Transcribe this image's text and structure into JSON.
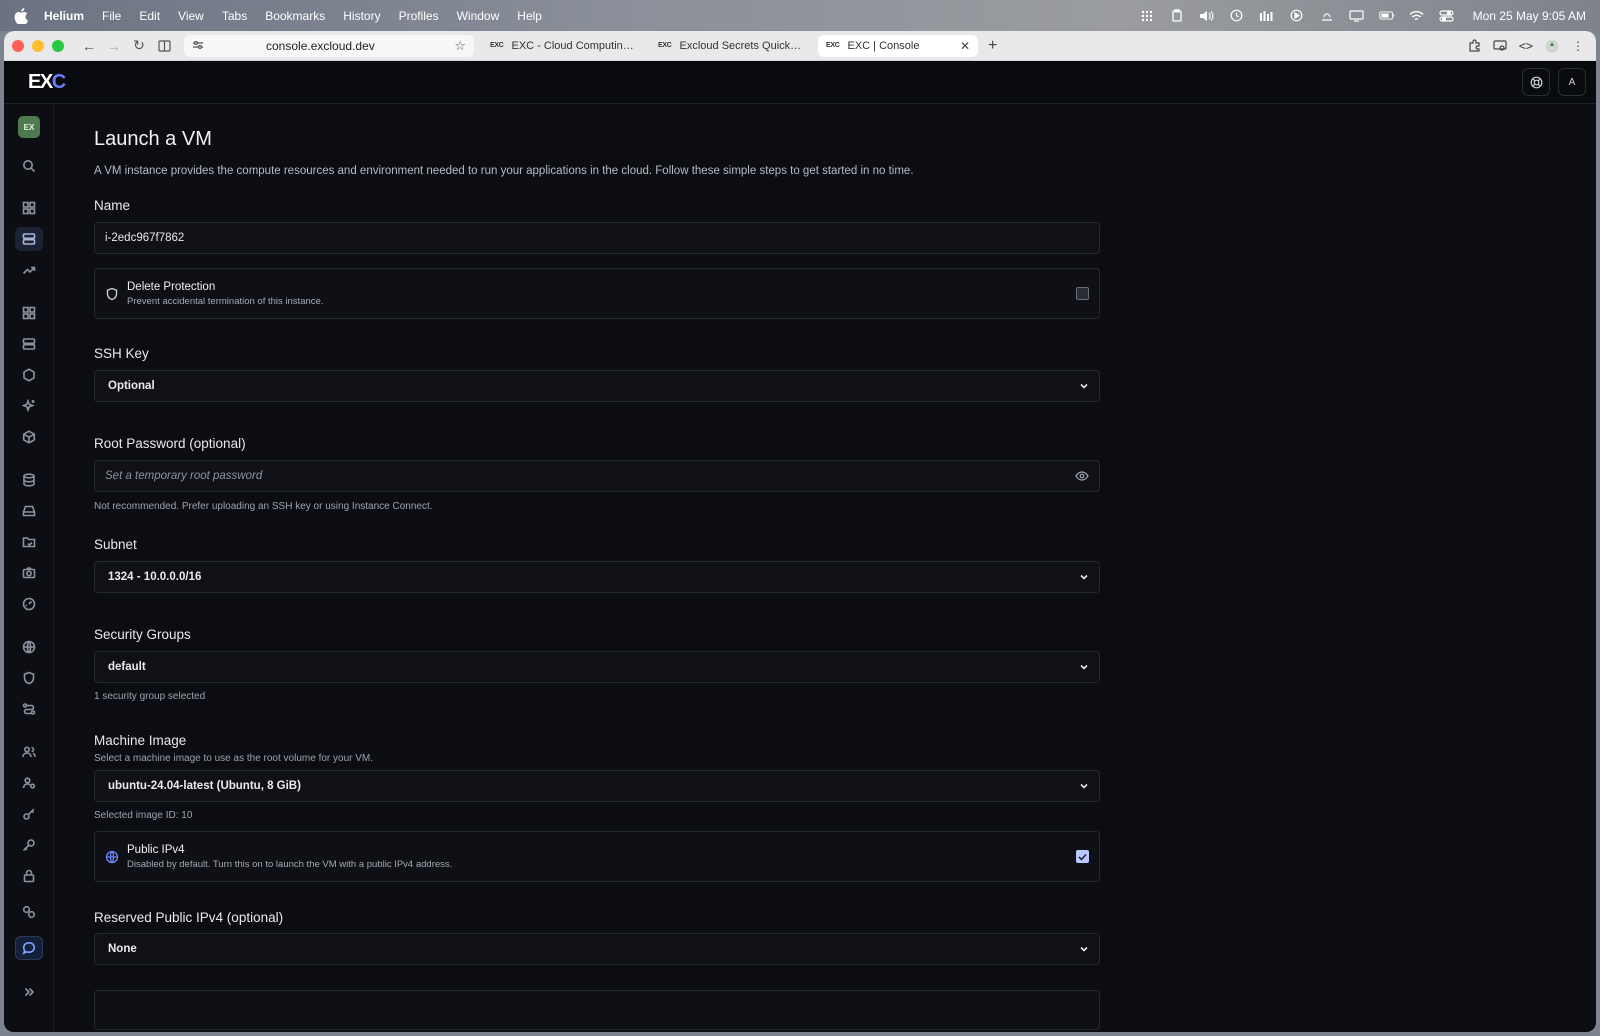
{
  "menubar": {
    "app": "Helium",
    "items": [
      "File",
      "Edit",
      "View",
      "Tabs",
      "Bookmarks",
      "History",
      "Profiles",
      "Window",
      "Help"
    ],
    "clock": "Mon 25 May  9:05 AM"
  },
  "browser": {
    "url": "console.excloud.dev",
    "tabs": [
      {
        "favicon": "EXC",
        "label": "EXC - Cloud Computing Serv"
      },
      {
        "favicon": "EXC",
        "label": "Excloud Secrets Quickstart"
      },
      {
        "favicon": "EXC",
        "label": "EXC | Console"
      }
    ]
  },
  "header": {
    "logo_main": "EX",
    "logo_accent": "C",
    "user_initial": "A"
  },
  "sidebar": {
    "workspace_badge": "EX"
  },
  "page": {
    "title": "Launch a VM",
    "subtitle": "A VM instance provides the compute resources and environment needed to run your applications in the cloud. Follow these simple steps to get started in no time.",
    "name": {
      "label": "Name",
      "value": "i-2edc967f7862"
    },
    "delete_protection": {
      "title": "Delete Protection",
      "description": "Prevent accidental termination of this instance.",
      "checked": false
    },
    "ssh_key": {
      "label": "SSH Key",
      "value": "Optional"
    },
    "root_password": {
      "label": "Root Password (optional)",
      "placeholder": "Set a temporary root password",
      "hint": "Not recommended. Prefer uploading an SSH key or using Instance Connect."
    },
    "subnet": {
      "label": "Subnet",
      "value": "1324 - 10.0.0.0/16"
    },
    "security_groups": {
      "label": "Security Groups",
      "value": "default",
      "hint": "1 security group selected"
    },
    "machine_image": {
      "label": "Machine Image",
      "description": "Select a machine image to use as the root volume for your VM.",
      "value": "ubuntu-24.04-latest (Ubuntu, 8 GiB)",
      "hint": "Selected image ID: 10"
    },
    "public_ipv4": {
      "title": "Public IPv4",
      "description": "Disabled by default. Turn this on to launch the VM with a public IPv4 address.",
      "checked": true
    },
    "reserved_ipv4": {
      "label": "Reserved Public IPv4 (optional)",
      "value": "None"
    }
  },
  "colors": {
    "accent": "#6d7cff",
    "checkbox_checked": "#b9c8ff",
    "background": "#0c0d12"
  }
}
